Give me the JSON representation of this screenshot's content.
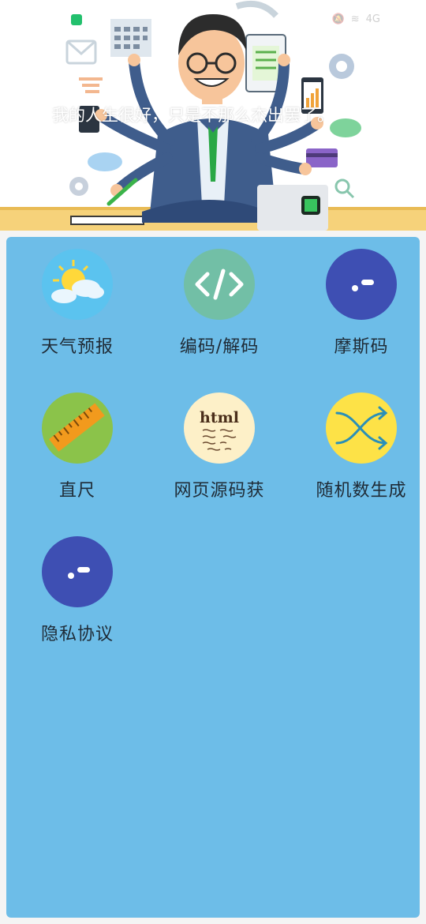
{
  "header": {
    "motto": "我的人生很好，只是不那么杰出罢了。",
    "status_network": "4G"
  },
  "tools": [
    {
      "label": "天气预报",
      "icon": "weather-icon",
      "color": "#5bc3ef"
    },
    {
      "label": "编码/解码",
      "icon": "code-icon",
      "color": "#72bfa6"
    },
    {
      "label": "摩斯码",
      "icon": "morse-icon",
      "color": "#3e4fb3"
    },
    {
      "label": "直尺",
      "icon": "ruler-icon",
      "color": "#8bc34a"
    },
    {
      "label": "网页源码获",
      "icon": "html-note-icon",
      "color": "#fdf0c8"
    },
    {
      "label": "随机数生成",
      "icon": "shuffle-icon",
      "color": "#fde247"
    },
    {
      "label": "隐私协议",
      "icon": "privacy-icon",
      "color": "#3e4fb3"
    }
  ]
}
